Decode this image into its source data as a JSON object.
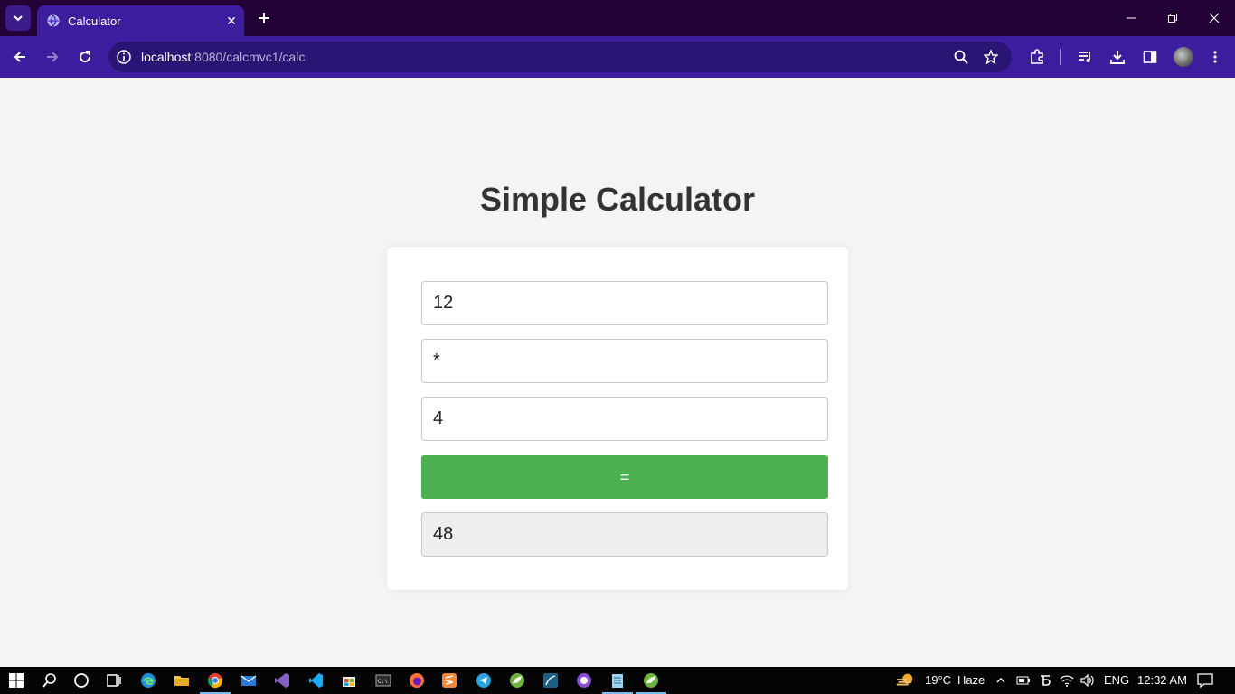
{
  "browser": {
    "tab": {
      "title": "Calculator"
    },
    "address": {
      "host": "localhost",
      "path": ":8080/calcmvc1/calc"
    }
  },
  "page": {
    "title": "Simple Calculator",
    "form": {
      "first_number": "12",
      "operator": "*",
      "second_number": "4",
      "equals_label": "=",
      "result": "48"
    }
  },
  "taskbar": {
    "weather": {
      "temperature": "19°C",
      "condition": "Haze"
    },
    "language": "ENG",
    "time": "12:32 AM",
    "apps": [
      "start-icon",
      "search-icon",
      "cortana-icon",
      "task-view-icon",
      "edge-icon",
      "file-explorer-icon",
      "chrome-icon",
      "mail-icon",
      "visual-studio-icon",
      "vscode-icon",
      "store-icon",
      "terminal-icon",
      "firefox-icon",
      "sublime-icon",
      "telegram-icon",
      "spring-icon",
      "mysql-workbench-icon",
      "github-desktop-icon",
      "notepad-icon",
      "spring-tool-icon"
    ]
  },
  "colors": {
    "accent": "#3b1d9e",
    "titlebar": "#230035",
    "equals_button": "#4caf50"
  }
}
